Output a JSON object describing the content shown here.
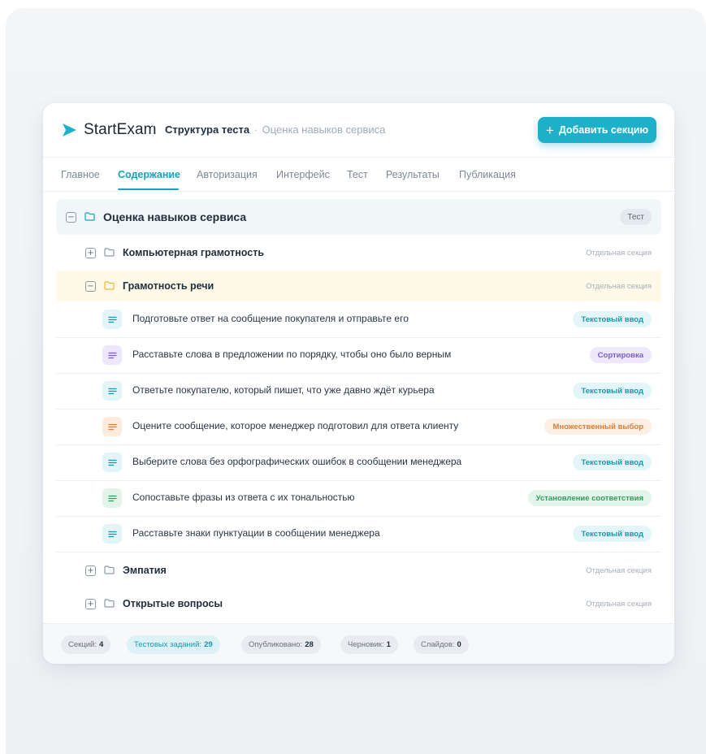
{
  "app": {
    "name": "StartExam"
  },
  "breadcrumb": {
    "title": "Структура теста",
    "separator": "·",
    "subtitle": "Оценка навыков сервиса"
  },
  "toolbar": {
    "add_section_label": "Добавить секцию",
    "add_icon": "plus-icon"
  },
  "tabs": [
    {
      "label": "Главное",
      "active": false
    },
    {
      "label": "Содержание",
      "active": true
    },
    {
      "label": "Авторизация",
      "active": false
    },
    {
      "label": "Интерфейс",
      "active": false
    },
    {
      "label": "Тест",
      "active": false
    },
    {
      "label": "Результаты",
      "active": false
    },
    {
      "label": "Публикация",
      "active": false
    }
  ],
  "tree": {
    "root": {
      "title": "Оценка навыков сервиса",
      "badge": "Тест",
      "toggle": "−",
      "expanded": true
    },
    "sections": [
      {
        "title": "Компьютерная грамотность",
        "meta": "Отдельная секция",
        "toggle": "+",
        "expanded": false
      },
      {
        "title": "Грамотность речи",
        "meta": "Отдельная секция",
        "toggle": "−",
        "expanded": true,
        "highlight_color": "#fff9e8"
      },
      {
        "title": "Эмпатия",
        "meta": "Отдельная секция",
        "toggle": "+",
        "expanded": false
      },
      {
        "title": "Открытые вопросы",
        "meta": "Отдельная секция",
        "toggle": "+",
        "expanded": false
      }
    ],
    "questions": [
      {
        "text": "Подготовьте ответ на сообщение покупателя и отправьте его",
        "type": "Текстовый ввод",
        "kind": "text"
      },
      {
        "text": "Расставьте слова в предложении по порядку, чтобы оно было верным",
        "type": "Сортировка",
        "kind": "sort"
      },
      {
        "text": "Ответьте покупателю, который пишет, что уже давно ждёт курьера",
        "type": "Текстовый ввод",
        "kind": "text"
      },
      {
        "text": "Оцените сообщение, которое менеджер подготовил для ответа клиенту",
        "type": "Множественный выбор",
        "kind": "multi"
      },
      {
        "text": "Выберите слова без орфографических ошибок в сообщении менеджера",
        "type": "Текстовый ввод",
        "kind": "text"
      },
      {
        "text": "Сопоставьте фразы из ответа с их тональностью",
        "type": "Установление соответствия",
        "kind": "match"
      },
      {
        "text": "Расставьте знаки пунктуации в сообщении менеджера",
        "type": "Текстовый ввод",
        "kind": "text"
      }
    ]
  },
  "stats": [
    {
      "label": "Секций:",
      "value": "4",
      "accent": false
    },
    {
      "label": "Тестовых заданий:",
      "value": "29",
      "accent": true
    },
    {
      "label": "Опубликовано:",
      "value": "28",
      "accent": false
    },
    {
      "label": "Черновик:",
      "value": "1",
      "accent": false
    },
    {
      "label": "Слайдов:",
      "value": "0",
      "accent": false
    }
  ],
  "colors": {
    "accent": "#1fb0c9",
    "text_type": "#1797ae",
    "sort_type": "#7a5ad8",
    "multi_type": "#e07c32",
    "match_type": "#2f9c5c",
    "folder_highlight": "#f0b53c"
  }
}
